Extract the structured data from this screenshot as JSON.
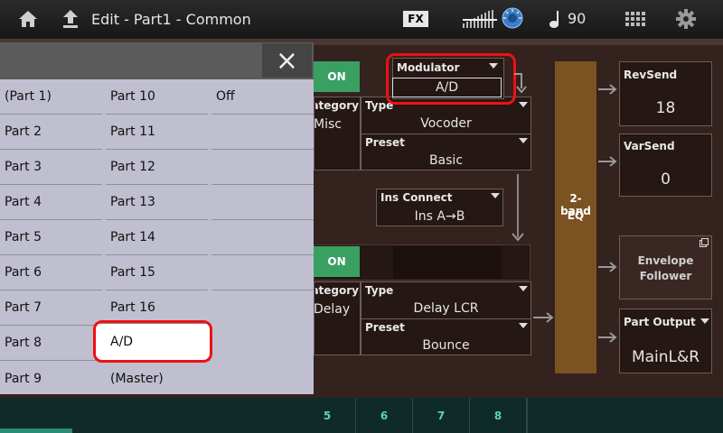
{
  "topbar": {
    "title": "Edit - Part1 - Common",
    "fx_label": "FX",
    "tempo": "90",
    "icons": [
      "home-icon",
      "up-arrow-icon",
      "fx-icon",
      "level-meter-icon",
      "dial-icon",
      "note-icon",
      "keyboard-grid-icon",
      "gear-icon"
    ]
  },
  "effect": {
    "ins_a": {
      "on_label": "ON",
      "category_label": "Category",
      "category_value": "Misc",
      "type_label": "Type",
      "type_value": "Vocoder",
      "preset_label": "Preset",
      "preset_value": "Basic"
    },
    "modulator": {
      "label": "Modulator",
      "value": "A/D"
    },
    "ins_connect": {
      "label": "Ins Connect",
      "value": "Ins A→B"
    },
    "ins_b": {
      "on_label": "ON",
      "category_label": "Category",
      "category_value": "Delay",
      "type_label": "Type",
      "type_value": "Delay LCR",
      "preset_label": "Preset",
      "preset_value": "Bounce"
    },
    "eq": {
      "line1": "2-band",
      "line2": "EQ"
    },
    "rev_send": {
      "label": "RevSend",
      "value": "18"
    },
    "var_send": {
      "label": "VarSend",
      "value": "0"
    },
    "envelope": {
      "line1": "Envelope",
      "line2": "Follower"
    },
    "part_output": {
      "label": "Part Output",
      "value": "MainL&R"
    }
  },
  "popup": {
    "close_symbol": "×",
    "columns": [
      [
        "(Part 1)",
        "Part 2",
        "Part 3",
        "Part 4",
        "Part 5",
        "Part 6",
        "Part 7",
        "Part 8",
        "Part 9"
      ],
      [
        "Part 10",
        "Part 11",
        "Part 12",
        "Part 13",
        "Part 14",
        "Part 15",
        "Part 16",
        "A/D",
        "(Master)"
      ],
      [
        "Off",
        "",
        "",
        "",
        "",
        "",
        "",
        "",
        ""
      ]
    ],
    "selected": "A/D"
  },
  "bottom_tabs": [
    "5",
    "6",
    "7",
    "8"
  ],
  "colors": {
    "on_green": "#3aa061",
    "eq_brown": "#7b5222",
    "highlight_red": "#e11111",
    "tab_teal": "#5fd2b4"
  }
}
